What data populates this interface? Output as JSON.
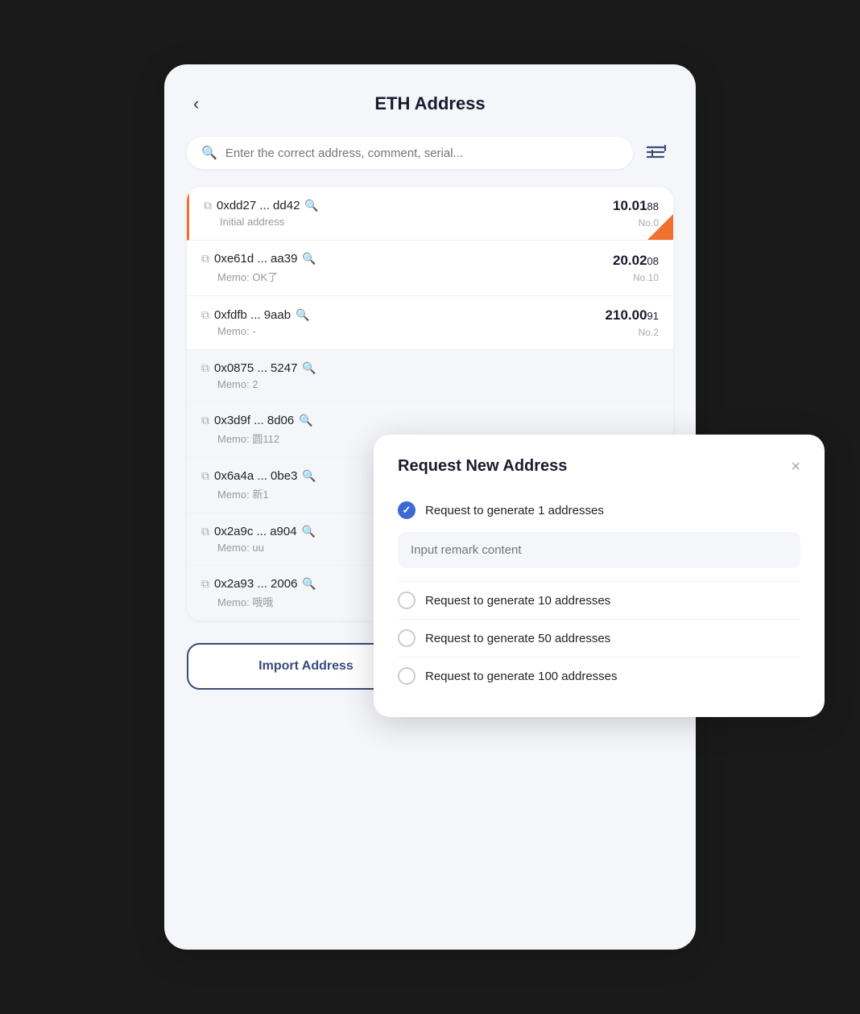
{
  "header": {
    "back_label": "‹",
    "title": "ETH Address"
  },
  "search": {
    "placeholder": "Enter the correct address, comment, serial...",
    "filter_icon": "≡↕"
  },
  "address_list": [
    {
      "address": "0xdd27 ... dd42",
      "memo": "Initial address",
      "amount_main": "10.01",
      "amount_decimal": "88",
      "number": "No.0",
      "active": true
    },
    {
      "address": "0xe61d ... aa39",
      "memo": "Memo: OK了",
      "amount_main": "20.02",
      "amount_decimal": "08",
      "number": "No.10",
      "active": false
    },
    {
      "address": "0xfdfb ... 9aab",
      "memo": "Memo: -",
      "amount_main": "210.00",
      "amount_decimal": "91",
      "number": "No.2",
      "active": false
    },
    {
      "address": "0x0875 ... 5247",
      "memo": "Memo: 2",
      "amount_main": "",
      "amount_decimal": "",
      "number": "",
      "active": false
    },
    {
      "address": "0x3d9f ... 8d06",
      "memo": "Memo: 圆112",
      "amount_main": "",
      "amount_decimal": "",
      "number": "",
      "active": false
    },
    {
      "address": "0x6a4a ... 0be3",
      "memo": "Memo: 新1",
      "amount_main": "",
      "amount_decimal": "",
      "number": "",
      "active": false
    },
    {
      "address": "0x2a9c ... a904",
      "memo": "Memo: uu",
      "amount_main": "",
      "amount_decimal": "",
      "number": "",
      "active": false
    },
    {
      "address": "0x2a93 ... 2006",
      "memo": "Memo: 哦哦",
      "amount_main": "",
      "amount_decimal": "",
      "number": "",
      "active": false
    }
  ],
  "buttons": {
    "import": "Import Address",
    "request": "Request New Address"
  },
  "modal": {
    "title": "Request New Address",
    "close_icon": "×",
    "remark_placeholder": "Input remark content",
    "options": [
      {
        "label": "Request to generate 1 addresses",
        "checked": true
      },
      {
        "label": "Request to generate 10 addresses",
        "checked": false
      },
      {
        "label": "Request to generate 50 addresses",
        "checked": false
      },
      {
        "label": "Request to generate 100 addresses",
        "checked": false
      }
    ]
  }
}
